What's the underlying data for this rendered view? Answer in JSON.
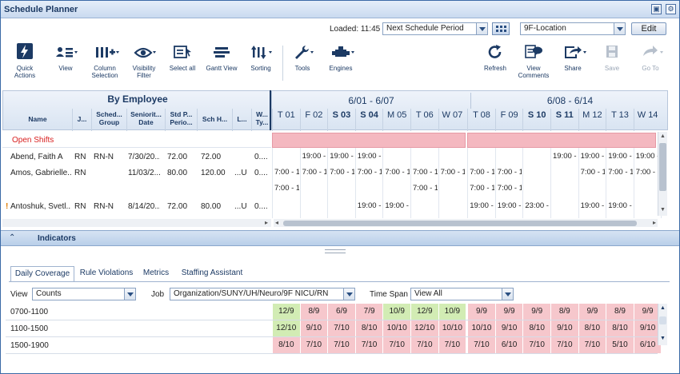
{
  "window": {
    "title": "Schedule Planner"
  },
  "controls": {
    "loaded": "Loaded: 11:45",
    "period": "Next Schedule Period",
    "location": "9F-Location",
    "edit": "Edit"
  },
  "toolbar": [
    {
      "label": "Quick Actions",
      "icon": "lightning-icon"
    },
    {
      "label": "View",
      "icon": "people-list-icon"
    },
    {
      "label": "Column Selection",
      "icon": "columns-icon"
    },
    {
      "label": "Visibility Filter",
      "icon": "eye-icon"
    },
    {
      "label": "Select all",
      "icon": "select-all-icon"
    },
    {
      "label": "Gantt View",
      "icon": "gantt-icon"
    },
    {
      "label": "Sorting",
      "icon": "sort-icon"
    },
    {
      "label": "Tools",
      "icon": "wrench-icon"
    },
    {
      "label": "Engines",
      "icon": "engine-icon"
    },
    {
      "label": "Refresh",
      "icon": "refresh-icon"
    },
    {
      "label": "View Comments",
      "icon": "comments-icon"
    },
    {
      "label": "Share",
      "icon": "share-icon"
    },
    {
      "label": "Save",
      "icon": "save-icon"
    },
    {
      "label": "Go To",
      "icon": "goto-icon"
    }
  ],
  "grid": {
    "group_title": "By Employee",
    "columns": [
      "Name",
      "J...",
      "Sched... Group",
      "Seniorit... Date",
      "Std P... Perio...",
      "Sch H...",
      "L...",
      "W... Ty..."
    ],
    "weeks": [
      "6/01 - 6/07",
      "6/08 - 6/14"
    ],
    "days": [
      {
        "label": "T 01",
        "bold": false
      },
      {
        "label": "F 02",
        "bold": false
      },
      {
        "label": "S 03",
        "bold": true
      },
      {
        "label": "S 04",
        "bold": true
      },
      {
        "label": "M 05",
        "bold": false
      },
      {
        "label": "T 06",
        "bold": false
      },
      {
        "label": "W 07",
        "bold": false
      },
      {
        "label": "T 08",
        "bold": false
      },
      {
        "label": "F 09",
        "bold": false
      },
      {
        "label": "S 10",
        "bold": true
      },
      {
        "label": "S 11",
        "bold": true
      },
      {
        "label": "M 12",
        "bold": false
      },
      {
        "label": "T 13",
        "bold": false
      },
      {
        "label": "W 14",
        "bold": false
      }
    ],
    "open_shifts_label": "Open Shifts",
    "rows": [
      {
        "name": "Abend, Faith A",
        "job": "RN",
        "group": "RN-N",
        "seniority": "7/30/20...",
        "std": "72.00",
        "sch": "72.00",
        "l": "",
        "w": "0....",
        "flag": false,
        "shifts": [
          [
            "",
            "19:00 -",
            "19:00 -",
            "19:00 -",
            "",
            "",
            "",
            "",
            "",
            "",
            "19:00 -",
            "19:00 -",
            "19:00 -",
            "19:00 -"
          ]
        ]
      },
      {
        "name": "Amos, Gabrielle...",
        "job": "RN",
        "group": "",
        "seniority": "11/03/2...",
        "std": "80.00",
        "sch": "120.00",
        "l": "...U",
        "w": "0....",
        "flag": false,
        "shifts": [
          [
            "7:00 - 1",
            "7:00 - 1",
            "7:00 - 1",
            "7:00 - 1",
            "7:00 - 1",
            "7:00 - 1",
            "7:00 - 1",
            "7:00 - 1",
            "7:00 - 1",
            "",
            "",
            "7:00 - 1",
            "7:00 - 1",
            "7:00 - 1"
          ],
          [
            "7:00 - 1",
            "",
            "",
            "",
            "",
            "7:00 - 1",
            "",
            "7:00 - 1",
            "7:00 - 1",
            "",
            "",
            "",
            "",
            ""
          ]
        ]
      },
      {
        "name": "Antoshuk, Svetl...",
        "job": "RN",
        "group": "RN-N",
        "seniority": "8/14/20...",
        "std": "72.00",
        "sch": "80.00",
        "l": "...U",
        "w": "0....",
        "flag": true,
        "shifts": [
          [
            "",
            "",
            "",
            "19:00 -",
            "19:00 -",
            "",
            "",
            "19:00 -",
            "19:00 -",
            "23:00 -",
            "",
            "19:00 -",
            "19:00 -",
            ""
          ]
        ]
      }
    ]
  },
  "indicators": {
    "label": "Indicators",
    "tabs": [
      "Daily Coverage",
      "Rule Violations",
      "Metrics",
      "Staffing Assistant"
    ],
    "view_label": "View",
    "view_value": "Counts",
    "job_label": "Job",
    "job_value": "Organization/SUNY/UH/Neuro/9F NICU/RN",
    "timespan_label": "Time Span",
    "timespan_value": "View All",
    "coverage": [
      {
        "label": "0700-1100",
        "cells": [
          "12/9",
          "8/9",
          "6/9",
          "7/9",
          "10/9",
          "12/9",
          "10/9",
          "9/9",
          "9/9",
          "9/9",
          "8/9",
          "9/9",
          "8/9",
          "9/9"
        ]
      },
      {
        "label": "1100-1500",
        "cells": [
          "12/10",
          "9/10",
          "7/10",
          "8/10",
          "10/10",
          "12/10",
          "10/10",
          "10/10",
          "9/10",
          "8/10",
          "9/10",
          "8/10",
          "8/10",
          "9/10"
        ]
      },
      {
        "label": "1500-1900",
        "cells": [
          "8/10",
          "7/10",
          "7/10",
          "7/10",
          "7/10",
          "7/10",
          "7/10",
          "7/10",
          "6/10",
          "7/10",
          "7/10",
          "7/10",
          "5/10",
          "6/10"
        ]
      }
    ],
    "coverage_colors": [
      [
        "green",
        "red",
        "red",
        "red",
        "green",
        "green",
        "green",
        "red",
        "red",
        "red",
        "red",
        "red",
        "red",
        "red"
      ],
      [
        "green",
        "red",
        "red",
        "red",
        "red",
        "red",
        "red",
        "red",
        "red",
        "red",
        "red",
        "red",
        "red",
        "red"
      ],
      [
        "red",
        "red",
        "red",
        "red",
        "red",
        "red",
        "red",
        "red",
        "red",
        "red",
        "red",
        "red",
        "red",
        "red"
      ]
    ]
  }
}
